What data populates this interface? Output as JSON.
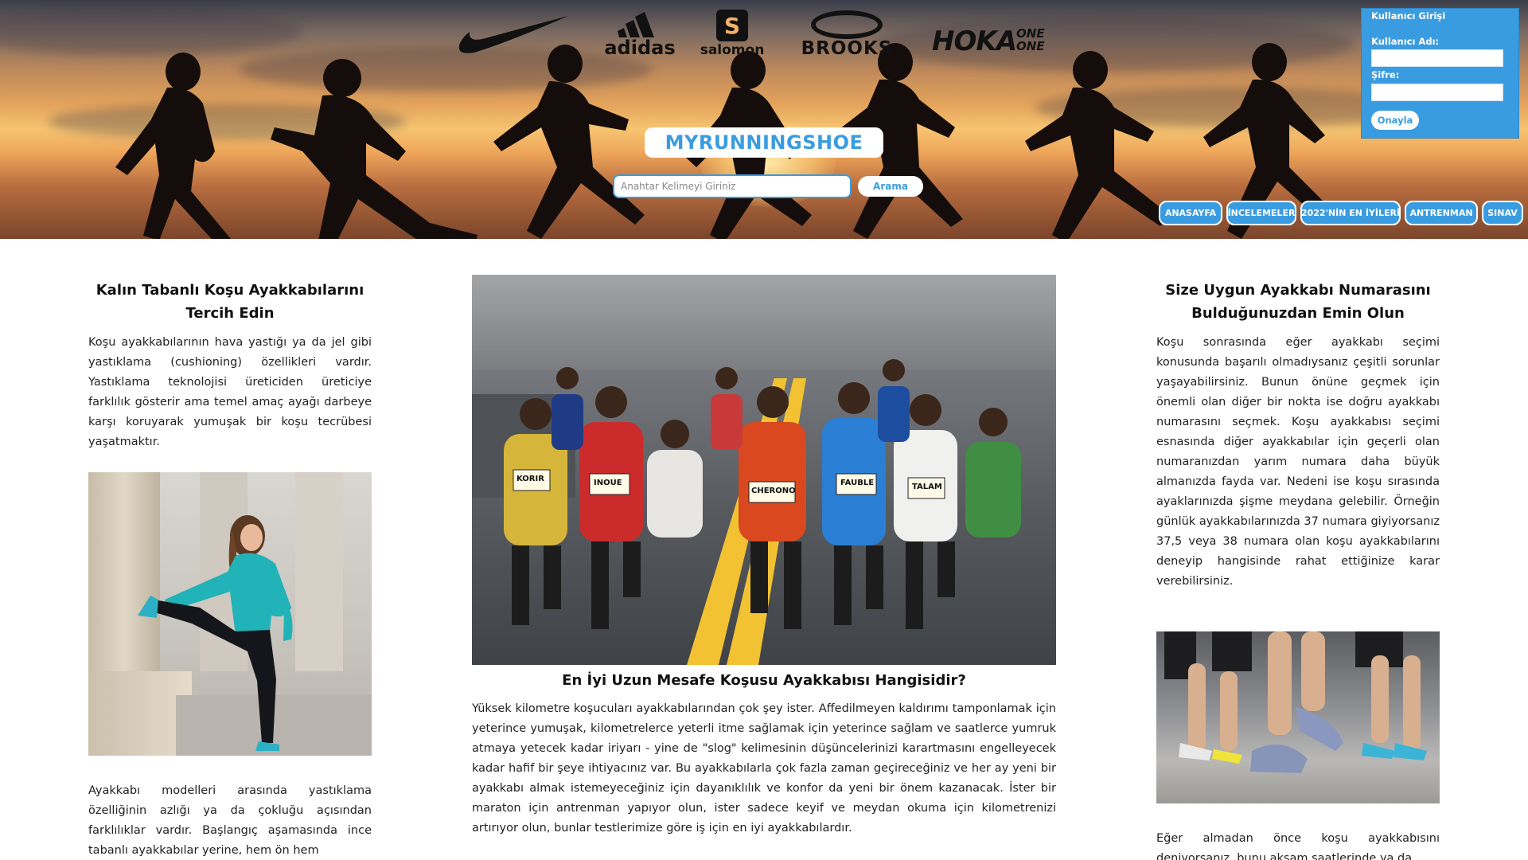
{
  "header": {
    "brands": [
      {
        "name": "swoosh-logo",
        "text": ""
      },
      {
        "name": "adidas-logo",
        "text": "adidas"
      },
      {
        "name": "salomon-logo",
        "text": "salomon"
      },
      {
        "name": "brooks-logo",
        "text": "BROOKS"
      },
      {
        "name": "hoka-logo",
        "text": "HOKA ONE ONE"
      }
    ],
    "site_title": "MYRUNNINGSHOE",
    "search": {
      "placeholder": "Anahtar Kelimeyi Giriniz",
      "value": "",
      "button_label": "Arama"
    },
    "login": {
      "title": "Kullanıcı Girişi",
      "username_label": "Kullanıcı Adı:",
      "username_value": "",
      "password_label": "Şifre:",
      "password_value": "",
      "submit_label": "Onayla"
    },
    "nav": [
      {
        "label": "ANASAYFA"
      },
      {
        "label": "İNCELEMELER"
      },
      {
        "label": "2022'NİN EN İYİLERİ"
      },
      {
        "label": "ANTRENMAN"
      },
      {
        "label": "SINAV"
      }
    ]
  },
  "left": {
    "title": "Kalın Tabanlı Koşu Ayakkabılarını Tercih Edin",
    "paragraph1": "Koşu ayakkabılarının hava yastığı ya da jel gibi yastıklama (cushioning) özellikleri vardır. Yastıklama teknolojisi üreticiden üreticiye farklılık gösterir ama temel amaç ayağı darbeye karşı koruyarak yumuşak bir koşu tecrübesi yaşatmaktır.",
    "paragraph2": "Ayakkabı modelleri arasında yastıklama özelliğinin azlığı ya da çokluğu açısından farklılıklar vardır. Başlangıç aşamasında ince tabanlı ayakkabılar yerine, hem ön hem"
  },
  "center": {
    "title": "En İyi Uzun Mesafe Koşusu Ayakkabısı Hangisidir?",
    "paragraph": "Yüksek kilometre koşucuları ayakkabılarından çok şey ister. Affedilmeyen kaldırımı tamponlamak için yeterince yumuşak, kilometrelerce yeterli itme sağlamak için yeterince sağlam ve saatlerce yumruk atmaya yetecek kadar iriyarı - yine de \"slog\" kelimesinin düşüncelerinizi karartmasını engelleyecek kadar hafif bir şeye ihtiyacınız var. Bu ayakkabılarla çok fazla zaman geçireceğiniz ve her ay yeni bir ayakkabı almak istemeyeceğiniz için dayanıklılık ve konfor da yeni bir önem kazanacak. İster bir maraton için antrenman yapıyor olun, ister sadece keyif ve meydan okuma için kilometrenizi artırıyor olun, bunlar testlerimize göre iş için en iyi ayakkabılardır.",
    "bibs": [
      "KORIR",
      "INOUE",
      "CHERONO",
      "FAUBLE",
      "TALAM"
    ]
  },
  "right": {
    "title": "Size Uygun Ayakkabı Numarasını Bulduğunuzdan Emin Olun",
    "paragraph1": "Koşu sonrasında eğer ayakkabı seçimi konusunda başarılı olmadıysanız çeşitli sorunlar yaşayabilirsiniz. Bunun önüne geçmek için önemli olan diğer bir nokta ise doğru ayakkabı numarasını seçmek. Koşu ayakkabısı seçimi esnasında diğer ayakkabılar için geçerli olan numaranızdan yarım numara daha büyük almanızda fayda var. Nedeni ise koşu sırasında ayaklarınızda şişme meydana gelebilir. Örneğin günlük ayakkabılarınızda 37 numara giyiyorsanız 37,5 veya 38 numara olan koşu ayakkabılarını deneyip hangisinde rahat ettiğinize karar verebilirsiniz.",
    "paragraph2": "Eğer almadan önce koşu ayakkabısını deniyorsanız, bunu akşam saatlerinde ya da"
  },
  "colors": {
    "accent": "#3a9ce0",
    "text": "#222222"
  }
}
